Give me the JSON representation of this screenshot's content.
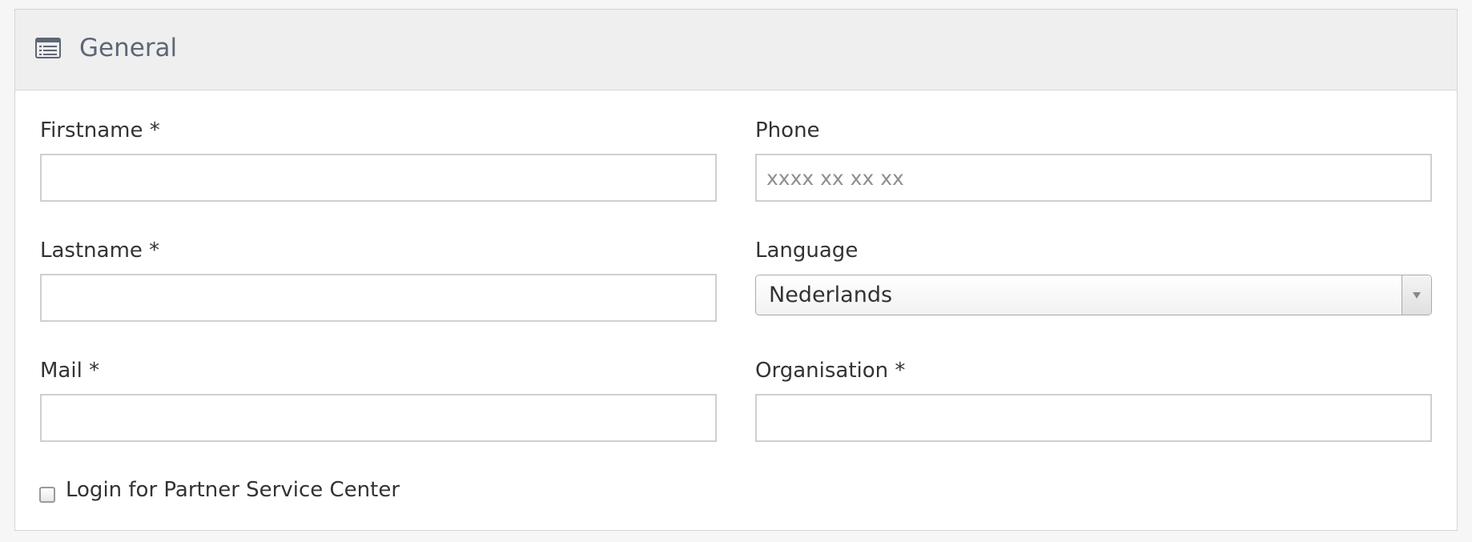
{
  "section": {
    "title": "General",
    "icon": "list-icon"
  },
  "form": {
    "firstname": {
      "label": "Firstname *",
      "value": ""
    },
    "lastname": {
      "label": "Lastname *",
      "value": ""
    },
    "mail": {
      "label": "Mail *",
      "value": ""
    },
    "phone": {
      "label": "Phone",
      "placeholder": "xxxx xx xx xx",
      "value": ""
    },
    "language": {
      "label": "Language",
      "selected": "Nederlands"
    },
    "organisation": {
      "label": "Organisation *",
      "value": ""
    },
    "partner_login": {
      "label": "Login for Partner Service Center",
      "checked": false
    }
  },
  "colors": {
    "header_background": "#efefef",
    "title_text": "#5e6675",
    "input_border": "#cfcfcf"
  }
}
